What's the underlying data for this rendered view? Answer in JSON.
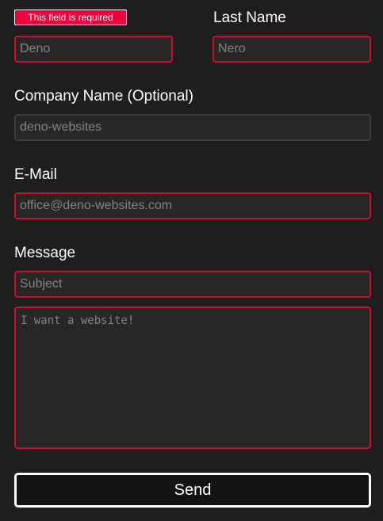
{
  "form": {
    "error_message": "This field is required",
    "first_name": {
      "placeholder": "Deno",
      "value": ""
    },
    "last_name": {
      "label": "Last Name",
      "placeholder": "Nero",
      "value": ""
    },
    "company": {
      "label": "Company Name (Optional)",
      "placeholder": "deno-websites",
      "value": ""
    },
    "email": {
      "label": "E-Mail",
      "placeholder": "office@deno-websites.com",
      "value": ""
    },
    "message": {
      "label": "Message",
      "subject_placeholder": "Subject",
      "body_placeholder": "I want a website!"
    },
    "send_label": "Send"
  },
  "colors": {
    "background": "#1e1e1f",
    "field_background": "#272728",
    "error_border": "#d10a35",
    "error_badge": "#f2003c",
    "button_border": "#ffffff"
  }
}
